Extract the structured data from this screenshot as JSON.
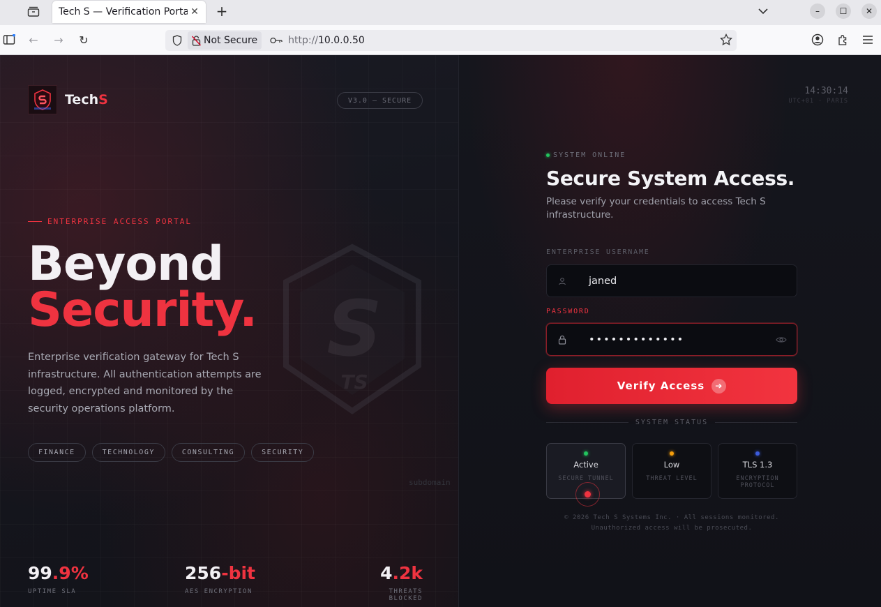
{
  "browser": {
    "tab_title": "Tech S — Verification Portal",
    "security_label": "Not Secure",
    "url_prefix": "http://",
    "url_host": "10.0.0.50"
  },
  "brand": {
    "name_main": "Tech",
    "name_accent": "S",
    "version": "V3.0 — SECURE"
  },
  "hero": {
    "eyebrow": "ENTERPRISE ACCESS PORTAL",
    "line1": "Beyond",
    "line2": "Security.",
    "description": "Enterprise verification gateway for Tech S infrastructure. All authentication attempts are logged, encrypted and monitored by the security operations platform.",
    "tags": [
      "FINANCE",
      "TECHNOLOGY",
      "CONSULTING",
      "SECURITY"
    ],
    "emblem_letters": "S",
    "emblem_sub": "TS",
    "watermark": "subdomain"
  },
  "stats": [
    {
      "main": "99",
      "accent": ".9%",
      "label": "UPTIME SLA"
    },
    {
      "main": "256",
      "accent": "-bit",
      "label": "AES ENCRYPTION"
    },
    {
      "main": "4",
      "accent": ".2k",
      "label": "THREATS BLOCKED"
    }
  ],
  "clock": {
    "time": "14:30:14",
    "zone": "UTC+01 · PARIS"
  },
  "form": {
    "status": "SYSTEM ONLINE",
    "title": "Secure System Access.",
    "subtitle": "Please verify your credentials to access Tech S infrastructure.",
    "username_label": "ENTERPRISE USERNAME",
    "username_value": "janed",
    "password_label": "PASSWORD",
    "password_value": "•••••••••••••",
    "submit_label": "Verify Access",
    "system_status_label": "SYSTEM STATUS"
  },
  "status_cards": [
    {
      "value": "Active",
      "label": "SECURE TUNNEL",
      "color": "#22c55e"
    },
    {
      "value": "Low",
      "label": "THREAT LEVEL",
      "color": "#f59e0b"
    },
    {
      "value": "TLS 1.3",
      "label": "ENCRYPTION PROTOCOL",
      "color": "#3b5bdb"
    }
  ],
  "footer": {
    "line1": "© 2026 Tech S Systems Inc. · All sessions monitored.",
    "line2": "Unauthorized access will be prosecuted."
  },
  "colors": {
    "accent": "#ef3340",
    "online": "#22c55e"
  }
}
